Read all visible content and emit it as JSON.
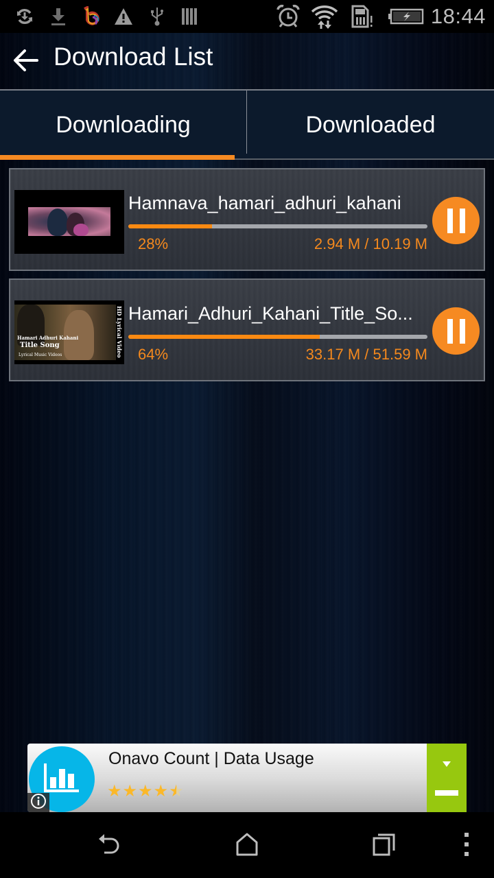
{
  "status_bar": {
    "time": "18:44",
    "left_icons": [
      "sync-download-icon",
      "download-icon",
      "app-logo-icon",
      "warning-icon",
      "usb-icon",
      "barcode-icon"
    ],
    "right_icons": [
      "alarm-icon",
      "wifi-icon",
      "sim-alert-icon",
      "battery-charging-icon"
    ]
  },
  "header": {
    "title": "Download List",
    "back_icon": "arrow-left-icon"
  },
  "tabs": [
    {
      "label": "Downloading",
      "active": true
    },
    {
      "label": "Downloaded",
      "active": false
    }
  ],
  "downloads": [
    {
      "name": "Hamnava_hamari_adhuri_kahani",
      "progress": 0.28,
      "percent_label": "28%",
      "size_label": "2.94 M / 10.19 M",
      "action_icon": "pause-icon"
    },
    {
      "name": "Hamari_Adhuri_Kahani_Title_So...",
      "progress": 0.64,
      "percent_label": "64%",
      "size_label": "33.17 M / 51.59 M",
      "action_icon": "pause-icon",
      "thumbnail_text": {
        "line1": "Hamari Adhuri Kahani",
        "line2": "Title Song",
        "line3": "Lyrical Music Videos",
        "vertical": "HD Lyrical Video"
      }
    }
  ],
  "ad": {
    "title": "Onavo Count | Data Usage",
    "rating": 4.5,
    "rating_max": 5,
    "colors": {
      "icon_bg": "#06b6e8",
      "cta_bg": "#97c80f",
      "star": "#fbb829"
    }
  },
  "nav_bar": {
    "buttons": [
      "back-icon",
      "home-icon",
      "recents-icon",
      "overflow-menu-icon"
    ]
  },
  "colors": {
    "accent": "#f68a22",
    "tab_bg": "#0c1a2c",
    "progress_track": "#a4a7ac"
  }
}
